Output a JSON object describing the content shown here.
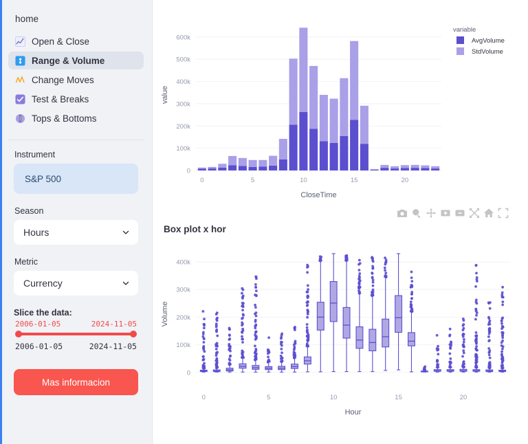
{
  "sidebar": {
    "home_label": "home",
    "nav_items": [
      {
        "label": "Open & Close",
        "icon": "line-chart-icon",
        "active": false
      },
      {
        "label": "Range & Volume",
        "icon": "up-down-arrow-icon",
        "active": true
      },
      {
        "label": "Change Moves",
        "icon": "zigzag-icon",
        "active": false
      },
      {
        "label": "Test & Breaks",
        "icon": "checkbox-icon",
        "active": false
      },
      {
        "label": "Tops & Bottoms",
        "icon": "thermometer-icon",
        "active": false
      }
    ],
    "instrument": {
      "label": "Instrument",
      "value": "S&P 500"
    },
    "season": {
      "label": "Season",
      "value": "Hours"
    },
    "metric": {
      "label": "Metric",
      "value": "Currency"
    },
    "slice": {
      "label": "Slice the data:",
      "handle_min": "2006-01-05",
      "handle_max": "2024-11-05",
      "end_min": "2006-01-05",
      "end_max": "2024-11-05"
    },
    "button": "Mas informacion",
    "colors": {
      "accent_red": "#f8564f",
      "accent_blue": "#3d7ff0",
      "panel_bg": "#f0f2f6",
      "pill_bg": "#d9e6f7"
    }
  },
  "modebar": {
    "buttons": [
      "camera-icon",
      "zoom-icon",
      "pan-icon",
      "zoom-in-icon",
      "zoom-out-icon",
      "autoscale-icon",
      "home-icon",
      "fullscreen-icon"
    ]
  },
  "boxplot_header": {
    "title": "Box plot x hor"
  },
  "chart_data": [
    {
      "id": "range-volume-bar-chart",
      "type": "bar",
      "title": "",
      "barmode": "stacked",
      "xlabel": "CloseTime",
      "ylabel": "value",
      "xlim": [
        -0.6,
        23.6
      ],
      "ylim": [
        0,
        680000
      ],
      "xticks": [
        0,
        5,
        10,
        15,
        20
      ],
      "yticks": [
        0,
        100000,
        200000,
        300000,
        400000,
        500000,
        600000
      ],
      "ytick_labels": [
        "0",
        "100k",
        "200k",
        "300k",
        "400k",
        "500k",
        "600k"
      ],
      "grid": true,
      "legend": {
        "title": "variable",
        "position": "right",
        "entries": [
          "AvgVolume",
          "StdVolume"
        ]
      },
      "categories": [
        0,
        1,
        2,
        3,
        4,
        5,
        6,
        7,
        8,
        9,
        10,
        11,
        12,
        13,
        14,
        15,
        16,
        17,
        18,
        19,
        20,
        21,
        22,
        23
      ],
      "series": [
        {
          "name": "AvgVolume",
          "color": "#5b4fd0",
          "values": [
            8000,
            9000,
            13000,
            24000,
            20000,
            16000,
            17000,
            22000,
            50000,
            206000,
            263000,
            187000,
            132000,
            124000,
            155000,
            228000,
            120000,
            3000,
            12000,
            9000,
            11000,
            12000,
            11000,
            9000
          ]
        },
        {
          "name": "StdVolume",
          "color": "#a9a0e8",
          "values": [
            5000,
            7000,
            17000,
            41000,
            36000,
            31000,
            30000,
            44000,
            92000,
            297000,
            379000,
            283000,
            208000,
            199000,
            260000,
            354000,
            171000,
            3000,
            13000,
            10000,
            13000,
            13000,
            12000,
            10000
          ]
        }
      ]
    },
    {
      "id": "volume-box-plot",
      "type": "box",
      "title": "Box plot x hor",
      "xlabel": "Hour",
      "ylabel": "Volume",
      "xlim": [
        -0.6,
        23.6
      ],
      "ylim": [
        -18000,
        440000
      ],
      "xticks": [
        0,
        5,
        10,
        15,
        20
      ],
      "yticks": [
        0,
        100000,
        200000,
        300000,
        400000
      ],
      "ytick_labels": [
        "0",
        "100k",
        "200k",
        "300k",
        "400k"
      ],
      "grid": true,
      "box_color": "#b0a8e4",
      "line_color": "#5b4fd0",
      "categories": [
        0,
        1,
        2,
        3,
        4,
        5,
        6,
        7,
        8,
        9,
        10,
        11,
        12,
        13,
        14,
        15,
        16,
        17,
        18,
        19,
        20,
        21,
        22,
        23
      ],
      "boxes": [
        {
          "x": 0,
          "min": 1000,
          "q1": 3000,
          "median": 5000,
          "q3": 8000,
          "max": 14000,
          "outliers_max": 224000
        },
        {
          "x": 1,
          "min": 1000,
          "q1": 3000,
          "median": 5000,
          "q3": 9000,
          "max": 16000,
          "outliers_max": 240000
        },
        {
          "x": 2,
          "min": 1000,
          "q1": 5000,
          "median": 9000,
          "q3": 15000,
          "max": 28000,
          "outliers_max": 187000
        },
        {
          "x": 3,
          "min": 1000,
          "q1": 15000,
          "median": 22000,
          "q3": 31000,
          "max": 53000,
          "outliers_max": 309000
        },
        {
          "x": 4,
          "min": 1000,
          "q1": 11000,
          "median": 17000,
          "q3": 25000,
          "max": 45000,
          "outliers_max": 348000
        },
        {
          "x": 5,
          "min": 1000,
          "q1": 10000,
          "median": 15000,
          "q3": 21000,
          "max": 37000,
          "outliers_max": 134000
        },
        {
          "x": 6,
          "min": 1000,
          "q1": 10000,
          "median": 15000,
          "q3": 22000,
          "max": 38000,
          "outliers_max": 141000
        },
        {
          "x": 7,
          "min": 1000,
          "q1": 14000,
          "median": 21000,
          "q3": 30000,
          "max": 52000,
          "outliers_max": 185000
        },
        {
          "x": 8,
          "min": 2000,
          "q1": 30000,
          "median": 42000,
          "q3": 56000,
          "max": 95000,
          "outliers_max": 430000
        },
        {
          "x": 9,
          "min": 2000,
          "q1": 153000,
          "median": 200000,
          "q3": 254000,
          "max": 404000,
          "outliers_max": 430000
        },
        {
          "x": 10,
          "min": 3000,
          "q1": 184000,
          "median": 251000,
          "q3": 329000,
          "max": 430000,
          "outliers_max": 430000
        },
        {
          "x": 11,
          "min": 3000,
          "q1": 124000,
          "median": 171000,
          "q3": 235000,
          "max": 405000,
          "outliers_max": 430000
        },
        {
          "x": 12,
          "min": 3000,
          "q1": 87000,
          "median": 117000,
          "q3": 165000,
          "max": 286000,
          "outliers_max": 430000
        },
        {
          "x": 13,
          "min": 3000,
          "q1": 78000,
          "median": 108000,
          "q3": 156000,
          "max": 277000,
          "outliers_max": 430000
        },
        {
          "x": 14,
          "min": 7000,
          "q1": 92000,
          "median": 129000,
          "q3": 193000,
          "max": 345000,
          "outliers_max": 430000
        },
        {
          "x": 15,
          "min": 9000,
          "q1": 145000,
          "median": 198000,
          "q3": 278000,
          "max": 430000,
          "outliers_max": 430000
        },
        {
          "x": 16,
          "min": 2000,
          "q1": 96000,
          "median": 113000,
          "q3": 144000,
          "max": 220000,
          "outliers_max": 402000
        },
        {
          "x": 17,
          "min": 1000,
          "q1": 2000,
          "median": 3000,
          "q3": 5000,
          "max": 9000,
          "outliers_max": 21000
        },
        {
          "x": 18,
          "min": 1000,
          "q1": 4000,
          "median": 6000,
          "q3": 10000,
          "max": 18000,
          "outliers_max": 145000
        },
        {
          "x": 19,
          "min": 1000,
          "q1": 4000,
          "median": 6000,
          "q3": 10000,
          "max": 18000,
          "outliers_max": 170000
        },
        {
          "x": 20,
          "min": 1000,
          "q1": 4000,
          "median": 6000,
          "q3": 11000,
          "max": 19000,
          "outliers_max": 200000
        },
        {
          "x": 21,
          "min": 1000,
          "q1": 4000,
          "median": 6000,
          "q3": 10000,
          "max": 18000,
          "outliers_max": 389000
        },
        {
          "x": 22,
          "min": 1000,
          "q1": 3000,
          "median": 5000,
          "q3": 9000,
          "max": 16000,
          "outliers_max": 265000
        },
        {
          "x": 23,
          "min": 1000,
          "q1": 3000,
          "median": 5000,
          "q3": 8000,
          "max": 15000,
          "outliers_max": 321000
        }
      ]
    }
  ]
}
